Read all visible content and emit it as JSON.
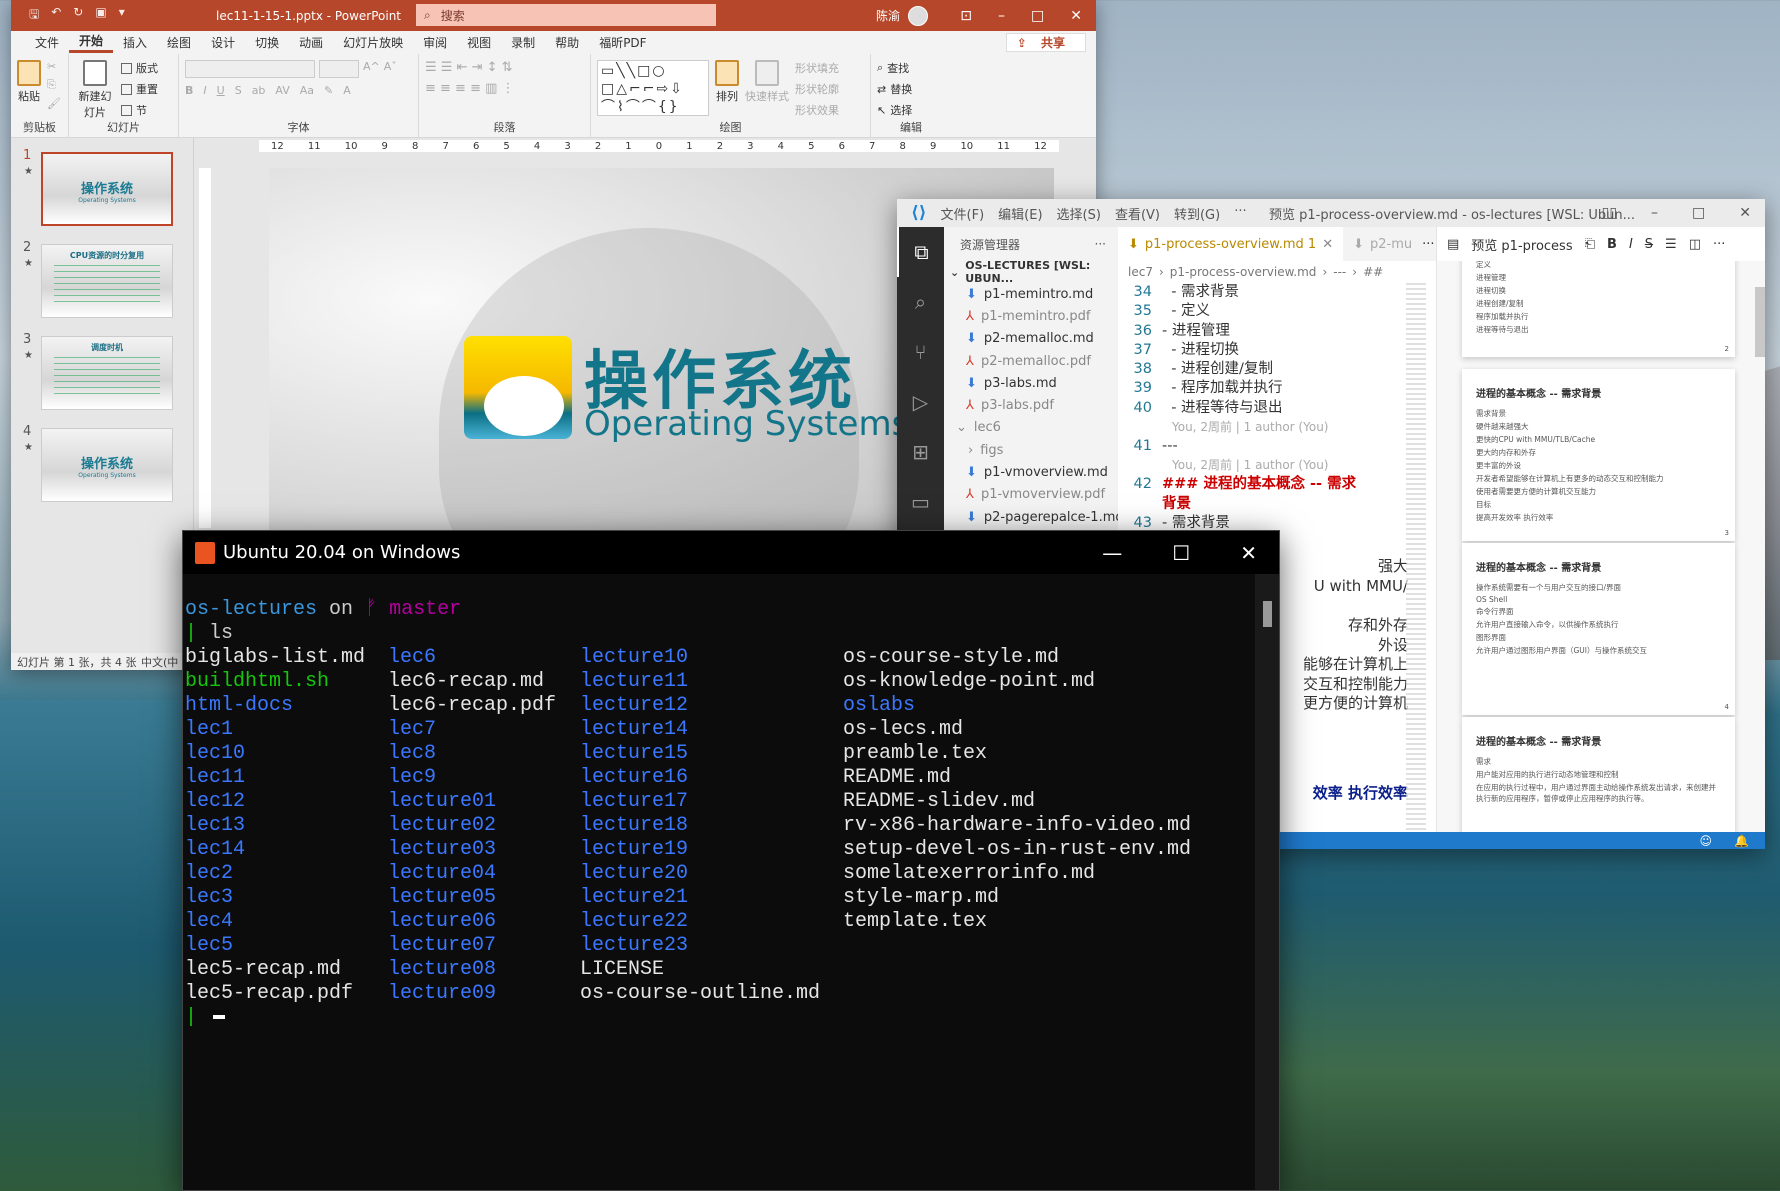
{
  "powerpoint": {
    "title": "lec11-1-15-1.pptx - PowerPoint",
    "search_placeholder": "搜索",
    "user": "陈渝",
    "share": "共享",
    "tabs": [
      "文件",
      "开始",
      "插入",
      "绘图",
      "设计",
      "切换",
      "动画",
      "幻灯片放映",
      "审阅",
      "视图",
      "录制",
      "帮助",
      "福昕PDF"
    ],
    "active_tab": "开始",
    "ribbon": {
      "clipboard": {
        "label": "剪贴板",
        "paste": "粘贴"
      },
      "slides": {
        "label": "幻灯片",
        "new_slide": "新建幻灯片",
        "layout": "版式",
        "reset": "重置",
        "section": "节"
      },
      "font": {
        "label": "字体",
        "bold": "B",
        "italic": "I",
        "underline": "U",
        "shadow": "S"
      },
      "paragraph": {
        "label": "段落"
      },
      "drawing": {
        "label": "绘图",
        "arrange": "排列",
        "quick_styles": "快速样式",
        "shape_fill": "形状填充",
        "shape_outline": "形状轮廓",
        "shape_effects": "形状效果"
      },
      "editing": {
        "label": "编辑",
        "find": "查找",
        "replace": "替换",
        "select": "选择"
      }
    },
    "ruler_h": [
      "12",
      "11",
      "10",
      "9",
      "8",
      "7",
      "6",
      "5",
      "4",
      "3",
      "2",
      "1",
      "0",
      "1",
      "2",
      "3",
      "4",
      "5",
      "6",
      "7",
      "8",
      "9",
      "10",
      "11",
      "12"
    ],
    "thumbnails": [
      {
        "num": "1",
        "title": "操作系统",
        "subtitle": "Operating Systems",
        "selected": true
      },
      {
        "num": "2",
        "title": "CPU资源的时分复用",
        "selected": false
      },
      {
        "num": "3",
        "title": "调度时机",
        "selected": false
      },
      {
        "num": "4",
        "title": "操作系统",
        "subtitle": "Operating Systems",
        "selected": false
      }
    ],
    "slide": {
      "title_cn": "操作系统",
      "title_en": "Operating Systems"
    },
    "status": {
      "slide_count": "幻灯片 第 1 张，共 4 张",
      "language": "中文(中"
    }
  },
  "vscode": {
    "menu": [
      "文件(F)",
      "编辑(E)",
      "选择(S)",
      "查看(V)",
      "转到(G)",
      "···"
    ],
    "window_title": "预览 p1-process-overview.md - os-lectures [WSL: Ubun...",
    "explorer": {
      "header": "资源管理器",
      "root": "OS-LECTURES [WSL: UBUN...",
      "items": [
        {
          "name": "p1-memintro.md",
          "type": "md"
        },
        {
          "name": "p1-memintro.pdf",
          "type": "pdf"
        },
        {
          "name": "p2-memalloc.md",
          "type": "md"
        },
        {
          "name": "p2-memalloc.pdf",
          "type": "pdf"
        },
        {
          "name": "p3-labs.md",
          "type": "md"
        },
        {
          "name": "p3-labs.pdf",
          "type": "pdf"
        },
        {
          "name": "lec6",
          "type": "folder-open"
        },
        {
          "name": "figs",
          "type": "folder"
        },
        {
          "name": "p1-vmoverview.md",
          "type": "md"
        },
        {
          "name": "p1-vmoverview.pdf",
          "type": "pdf"
        },
        {
          "name": "p2-pagerepalce-1.md",
          "type": "md"
        }
      ]
    },
    "tabs": [
      {
        "label": "p1-process-overview.md 1",
        "active": true
      },
      {
        "label": "p2-mu",
        "active": false
      }
    ],
    "breadcrumb": [
      "lec7",
      "p1-process-overview.md",
      "---",
      "##"
    ],
    "blame": "You, 2周前 | 1 author (You)",
    "lines": [
      {
        "n": "34",
        "text": "  - 需求背景"
      },
      {
        "n": "35",
        "text": "  - 定义"
      },
      {
        "n": "36",
        "text": "- 进程管理"
      },
      {
        "n": "37",
        "text": "  - 进程切换"
      },
      {
        "n": "38",
        "text": "  - 进程创建/复制"
      },
      {
        "n": "39",
        "text": "  - 程序加载并执行"
      },
      {
        "n": "40",
        "text": "  - 进程等待与退出"
      },
      {
        "n": "41",
        "text": "---",
        "blame_before": true
      },
      {
        "n": "42",
        "text": "### 进程的基本概念 -- 需求背景",
        "heading": true,
        "blame_before": true
      },
      {
        "n": "43",
        "text": "- 需求背景"
      }
    ],
    "hidden_wrap_fragments": [
      "强大",
      "U with MMU/",
      "存和外存",
      "外设",
      "能够在计算机上",
      "交互和控制能力",
      "更方便的计算机",
      "效率 执行效率"
    ],
    "preview": {
      "tab": "预览 p1-process",
      "cards": [
        {
          "title": "",
          "items": [
            "定义",
            "进程管理",
            "进程切换",
            "进程创建/复制",
            "程序加载并执行",
            "进程等待与退出"
          ],
          "page": "2"
        },
        {
          "title": "进程的基本概念 -- 需求背景",
          "items": [
            "需求背景",
            "硬件越来越强大",
            "更快的CPU with MMU/TLB/Cache",
            "更大的内存和外存",
            "更丰富的外设",
            "开发者希望能够在计算机上有更多的动态交互和控制能力",
            "使用者需要更方便的计算机交互能力",
            "目标",
            "提高开发效率 执行效率"
          ],
          "page": "3"
        },
        {
          "title": "进程的基本概念 -- 需求背景",
          "items": [
            "操作系统需要有一个与用户交互的接口/界面",
            "OS Shell",
            "命令行界面",
            "允许用户直接输入命令，以供操作系统执行",
            "图形界面",
            "允许用户通过图形用户界面（GUI）与操作系统交互"
          ],
          "page": "4"
        },
        {
          "title": "进程的基本概念 -- 需求背景",
          "items": [
            "需求",
            "用户能对应用的执行进行动态地管理和控制",
            "在应用的执行过程中，用户通过界面主动给操作系统发出请求，来创建并执行新的应用程序，暂停或停止应用程序的执行等。"
          ],
          "page": ""
        }
      ]
    }
  },
  "terminal": {
    "title": "Ubuntu 20.04 on Windows",
    "prompt_dir": "os-lectures",
    "prompt_on": "on",
    "branch_icon": "git-branch-icon",
    "branch": "master",
    "command": "ls",
    "colors": {
      "dir": "#3b78ff",
      "exec": "#16c60c",
      "file": "#e6e6e6",
      "prompt_dir": "#3a96dd",
      "branch": "#b4009e"
    },
    "ls_columns": [
      [
        {
          "name": "biglabs-list.md",
          "kind": "file"
        },
        {
          "name": "buildhtml.sh",
          "kind": "exec"
        },
        {
          "name": "html-docs",
          "kind": "dir"
        },
        {
          "name": "lec1",
          "kind": "dir"
        },
        {
          "name": "lec10",
          "kind": "dir"
        },
        {
          "name": "lec11",
          "kind": "dir"
        },
        {
          "name": "lec12",
          "kind": "dir"
        },
        {
          "name": "lec13",
          "kind": "dir"
        },
        {
          "name": "lec14",
          "kind": "dir"
        },
        {
          "name": "lec2",
          "kind": "dir"
        },
        {
          "name": "lec3",
          "kind": "dir"
        },
        {
          "name": "lec4",
          "kind": "dir"
        },
        {
          "name": "lec5",
          "kind": "dir"
        },
        {
          "name": "lec5-recap.md",
          "kind": "file"
        },
        {
          "name": "lec5-recap.pdf",
          "kind": "file"
        }
      ],
      [
        {
          "name": "lec6",
          "kind": "dir"
        },
        {
          "name": "lec6-recap.md",
          "kind": "file"
        },
        {
          "name": "lec6-recap.pdf",
          "kind": "file"
        },
        {
          "name": "lec7",
          "kind": "dir"
        },
        {
          "name": "lec8",
          "kind": "dir"
        },
        {
          "name": "lec9",
          "kind": "dir"
        },
        {
          "name": "lecture01",
          "kind": "dir"
        },
        {
          "name": "lecture02",
          "kind": "dir"
        },
        {
          "name": "lecture03",
          "kind": "dir"
        },
        {
          "name": "lecture04",
          "kind": "dir"
        },
        {
          "name": "lecture05",
          "kind": "dir"
        },
        {
          "name": "lecture06",
          "kind": "dir"
        },
        {
          "name": "lecture07",
          "kind": "dir"
        },
        {
          "name": "lecture08",
          "kind": "dir"
        },
        {
          "name": "lecture09",
          "kind": "dir"
        }
      ],
      [
        {
          "name": "lecture10",
          "kind": "dir"
        },
        {
          "name": "lecture11",
          "kind": "dir"
        },
        {
          "name": "lecture12",
          "kind": "dir"
        },
        {
          "name": "lecture14",
          "kind": "dir"
        },
        {
          "name": "lecture15",
          "kind": "dir"
        },
        {
          "name": "lecture16",
          "kind": "dir"
        },
        {
          "name": "lecture17",
          "kind": "dir"
        },
        {
          "name": "lecture18",
          "kind": "dir"
        },
        {
          "name": "lecture19",
          "kind": "dir"
        },
        {
          "name": "lecture20",
          "kind": "dir"
        },
        {
          "name": "lecture21",
          "kind": "dir"
        },
        {
          "name": "lecture22",
          "kind": "dir"
        },
        {
          "name": "lecture23",
          "kind": "dir"
        },
        {
          "name": "LICENSE",
          "kind": "file"
        },
        {
          "name": "os-course-outline.md",
          "kind": "file"
        }
      ],
      [
        {
          "name": "os-course-style.md",
          "kind": "file"
        },
        {
          "name": "os-knowledge-point.md",
          "kind": "file"
        },
        {
          "name": "oslabs",
          "kind": "dir"
        },
        {
          "name": "os-lecs.md",
          "kind": "file"
        },
        {
          "name": "preamble.tex",
          "kind": "file"
        },
        {
          "name": "README.md",
          "kind": "file"
        },
        {
          "name": "README-slidev.md",
          "kind": "file"
        },
        {
          "name": "rv-x86-hardware-info-video.md",
          "kind": "file"
        },
        {
          "name": "setup-devel-os-in-rust-env.md",
          "kind": "file"
        },
        {
          "name": "somelatexerrorinfo.md",
          "kind": "file"
        },
        {
          "name": "style-marp.md",
          "kind": "file"
        },
        {
          "name": "template.tex",
          "kind": "file"
        }
      ]
    ]
  }
}
